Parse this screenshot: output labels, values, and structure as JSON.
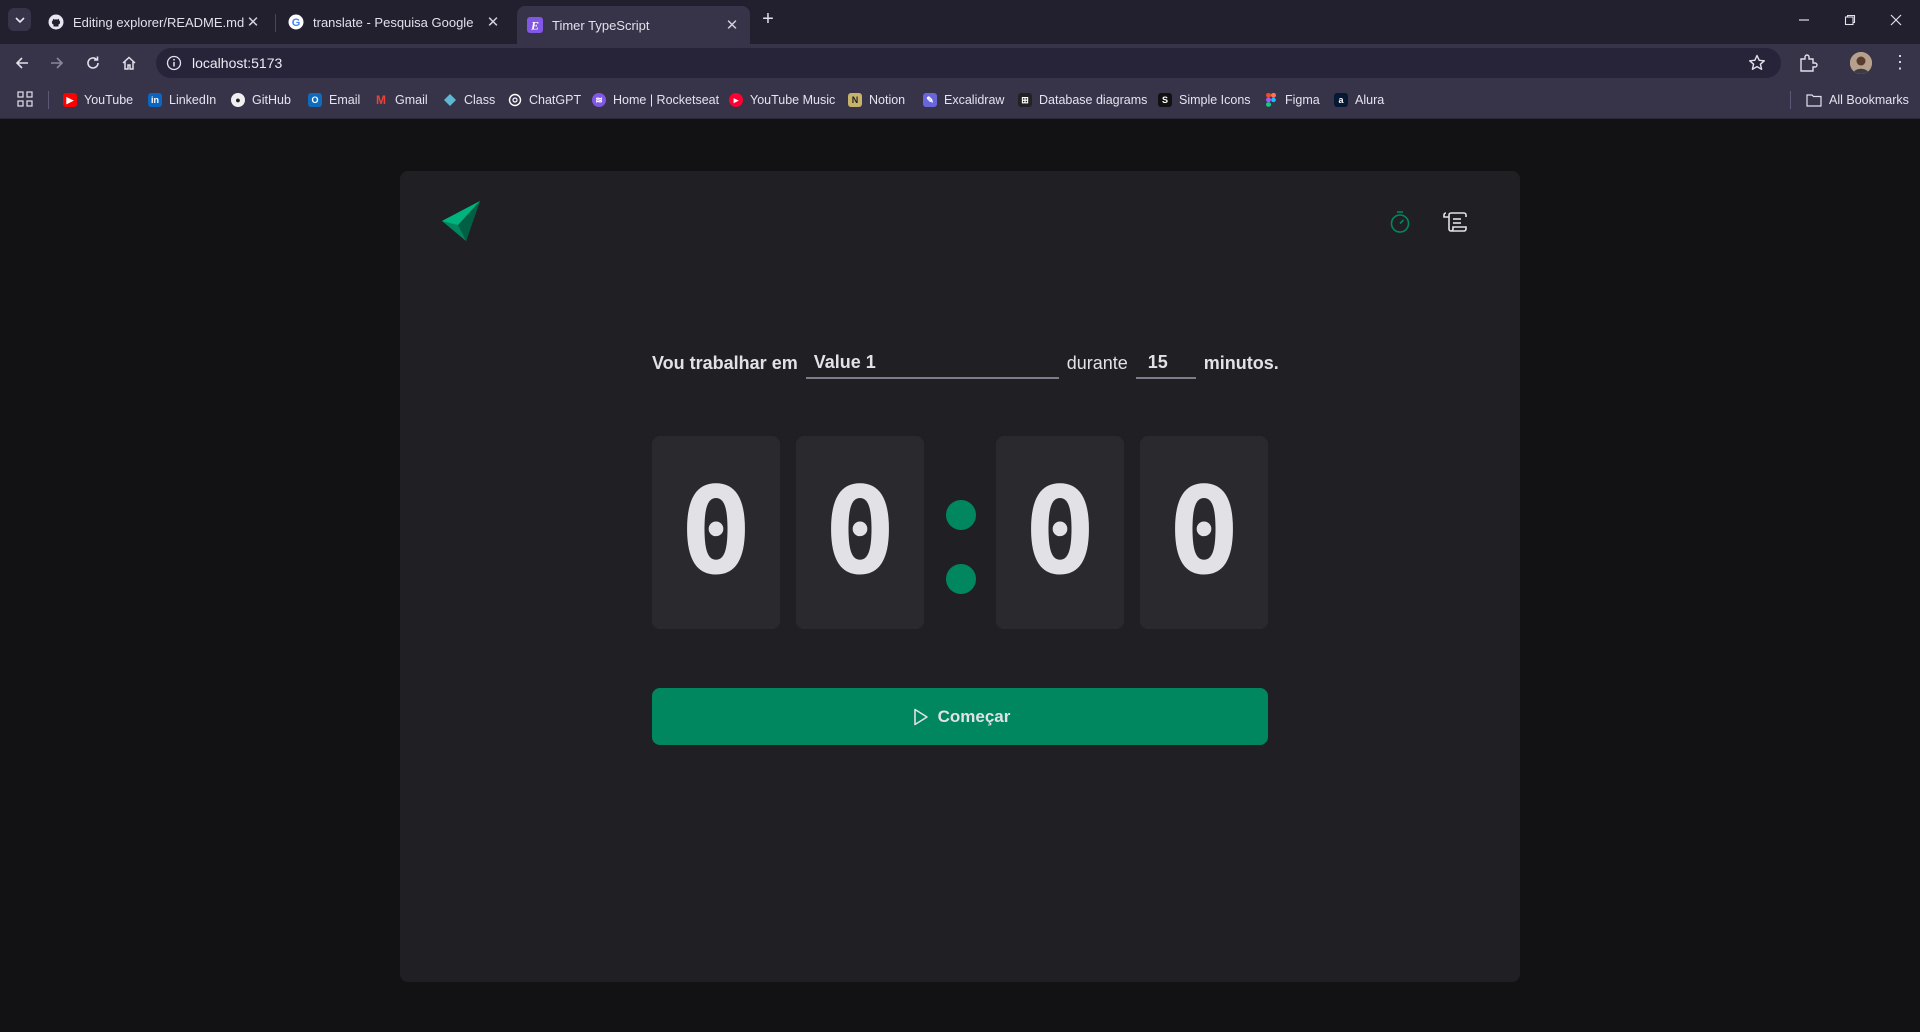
{
  "browser": {
    "tabs": [
      {
        "title": "Editing explorer/README.md at",
        "icon": "github-icon",
        "active": false
      },
      {
        "title": "translate - Pesquisa Google",
        "icon": "google-icon",
        "active": false
      },
      {
        "title": "Timer TypeScript",
        "icon": "e-favicon-icon",
        "active": true
      }
    ],
    "url": "localhost:5173",
    "bookmarks": [
      {
        "label": "YouTube",
        "icon": "youtube-icon",
        "color": "#ff0000"
      },
      {
        "label": "LinkedIn",
        "icon": "linkedin-icon",
        "color": "#0a66c2"
      },
      {
        "label": "GitHub",
        "icon": "github-icon",
        "color": "#ffffff"
      },
      {
        "label": "Email",
        "icon": "outlook-icon",
        "color": "#0f6cbd"
      },
      {
        "label": "Gmail",
        "icon": "gmail-icon",
        "color": "#ea4335"
      },
      {
        "label": "Class",
        "icon": "class-icon",
        "color": "#5fb7d4"
      },
      {
        "label": "ChatGPT",
        "icon": "chatgpt-icon",
        "color": "#ffffff"
      },
      {
        "label": "Home | Rocketseat",
        "icon": "rocketseat-icon",
        "color": "#8257e5"
      },
      {
        "label": "YouTube Music",
        "icon": "youtube-music-icon",
        "color": "#ff0033"
      },
      {
        "label": "Notion",
        "icon": "notion-icon",
        "color": "#c8b36a"
      },
      {
        "label": "Excalidraw",
        "icon": "excalidraw-icon",
        "color": "#6965db"
      },
      {
        "label": "Database diagrams",
        "icon": "dbdiagram-icon",
        "color": "#222222"
      },
      {
        "label": "Simple Icons",
        "icon": "simple-icons-icon",
        "color": "#111111"
      },
      {
        "label": "Figma",
        "icon": "figma-icon",
        "color": "#f24e1e"
      },
      {
        "label": "Alura",
        "icon": "alura-icon",
        "color": "#051933"
      }
    ],
    "all_bookmarks": "All Bookmarks"
  },
  "app": {
    "form": {
      "label_task": "Vou trabalhar em",
      "task_value": "Value 1",
      "label_during": "durante",
      "minutes_value": "15",
      "label_minutes": "minutos."
    },
    "countdown": {
      "digits": [
        "0",
        "0",
        "0",
        "0"
      ],
      "separator": ":"
    },
    "start_button": "Começar",
    "colors": {
      "brand": "#00875f",
      "card": "#202024",
      "digit_bg": "#29292e",
      "text": "#e1e1e6"
    }
  }
}
